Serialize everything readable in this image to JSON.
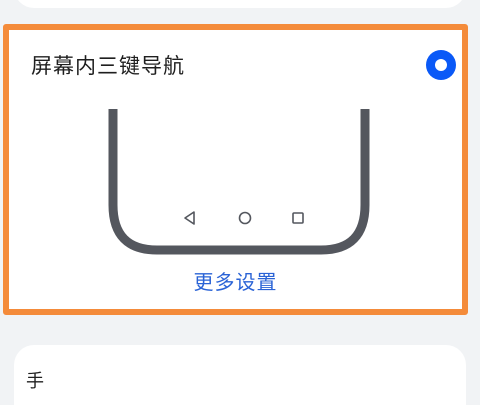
{
  "option": {
    "title": "屏幕内三键导航",
    "selected": true,
    "more_settings_label": "更多设置"
  },
  "nav_bar": {
    "icons": [
      "back-triangle-icon",
      "home-circle-icon",
      "recents-square-icon"
    ]
  },
  "next_card": {
    "title_partial": "手"
  },
  "colors": {
    "accent": "#0a59f7",
    "link": "#2a63d6",
    "highlight": "#f48b3a",
    "background": "#f1f3f5"
  }
}
